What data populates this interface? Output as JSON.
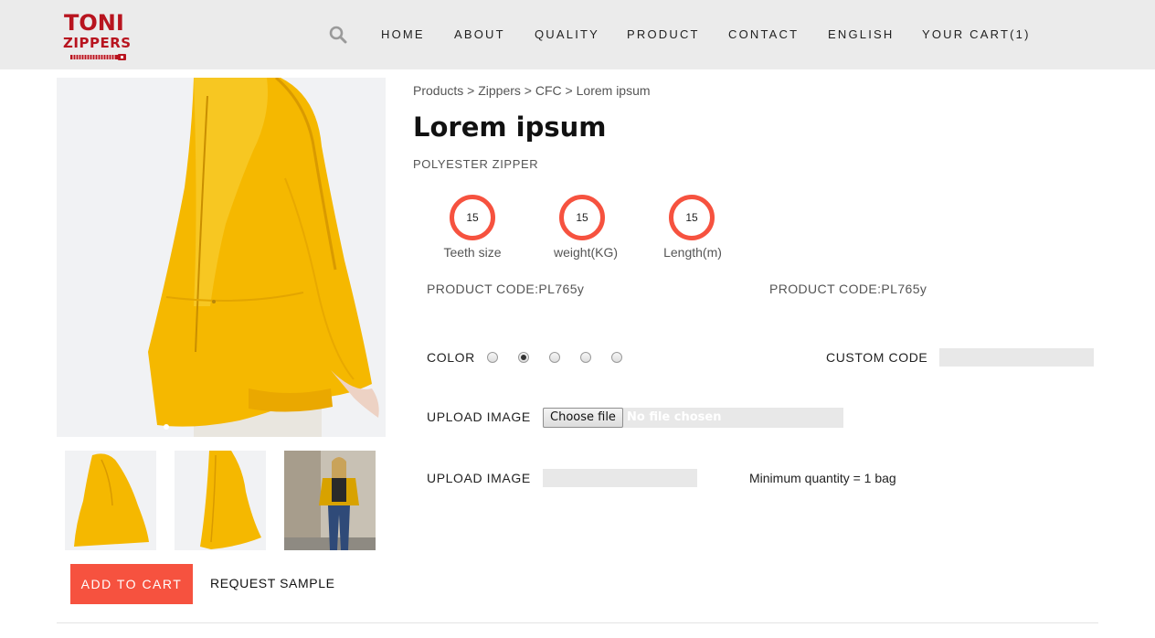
{
  "brand": {
    "line1": "TONI",
    "line2": "ZIPPERS",
    "color": "#b8141f"
  },
  "nav": {
    "search_icon": "search-icon",
    "items": [
      "HOME",
      "ABOUT",
      "QUALITY",
      "PRODUCT",
      "CONTACT",
      "ENGLISH",
      "YOUR CART(1)"
    ]
  },
  "breadcrumb": {
    "items": [
      "Products",
      "Zippers",
      "CFC",
      "Lorem ipsum"
    ],
    "separator": ">"
  },
  "product": {
    "title": "Lorem ipsum",
    "subtitle": "POLYESTER ZIPPER",
    "stats": [
      {
        "value": "15",
        "label": "Teeth size"
      },
      {
        "value": "15",
        "label": "weight(KG)"
      },
      {
        "value": "15",
        "label": "Length(m)"
      }
    ],
    "codes": [
      "PRODUCT CODE:PL765y",
      "PRODUCT CODE:PL765y"
    ]
  },
  "options": {
    "color_label": "COLOR",
    "color_choices": 5,
    "color_selected_index": 1,
    "custom_code_label": "CUSTOM CODE",
    "custom_code_value": "",
    "upload_label_1": "UPLOAD IMAGE",
    "file_button": "Choose file",
    "file_status": "No file chosen",
    "upload_label_2": "UPLOAD IMAGE",
    "upload_value_2": "",
    "min_quantity": "Minimum quantity = 1 bag"
  },
  "actions": {
    "add_to_cart": "ADD TO CART",
    "request_sample": "REQUEST SAMPLE"
  },
  "colors": {
    "accent": "#f6523f",
    "header_bg": "#ebebeb",
    "jacket": "#f5b800",
    "input_bg": "#e8e8e8"
  }
}
